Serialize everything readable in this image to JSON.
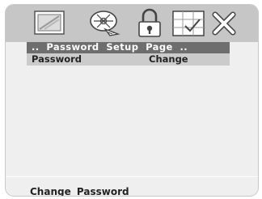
{
  "toolbar": {
    "icons": [
      {
        "name": "general-setup-icon"
      },
      {
        "name": "video-setup-icon"
      },
      {
        "name": "password-setup-icon",
        "selected": true
      },
      {
        "name": "preference-setup-icon"
      },
      {
        "name": "exit-setup-icon"
      }
    ]
  },
  "section": {
    "title": "..  Password  Setup  Page  .."
  },
  "menu": {
    "items": [
      {
        "label": "Password",
        "value": "Change"
      }
    ]
  },
  "status": {
    "text": "Change  Password"
  },
  "colors": {
    "panel_bg": "#efefef",
    "toolbar_bg": "#c6c6c6",
    "section_bar": "#6e6e6e",
    "highlight": "#cbcbcb",
    "text": "#222222"
  }
}
